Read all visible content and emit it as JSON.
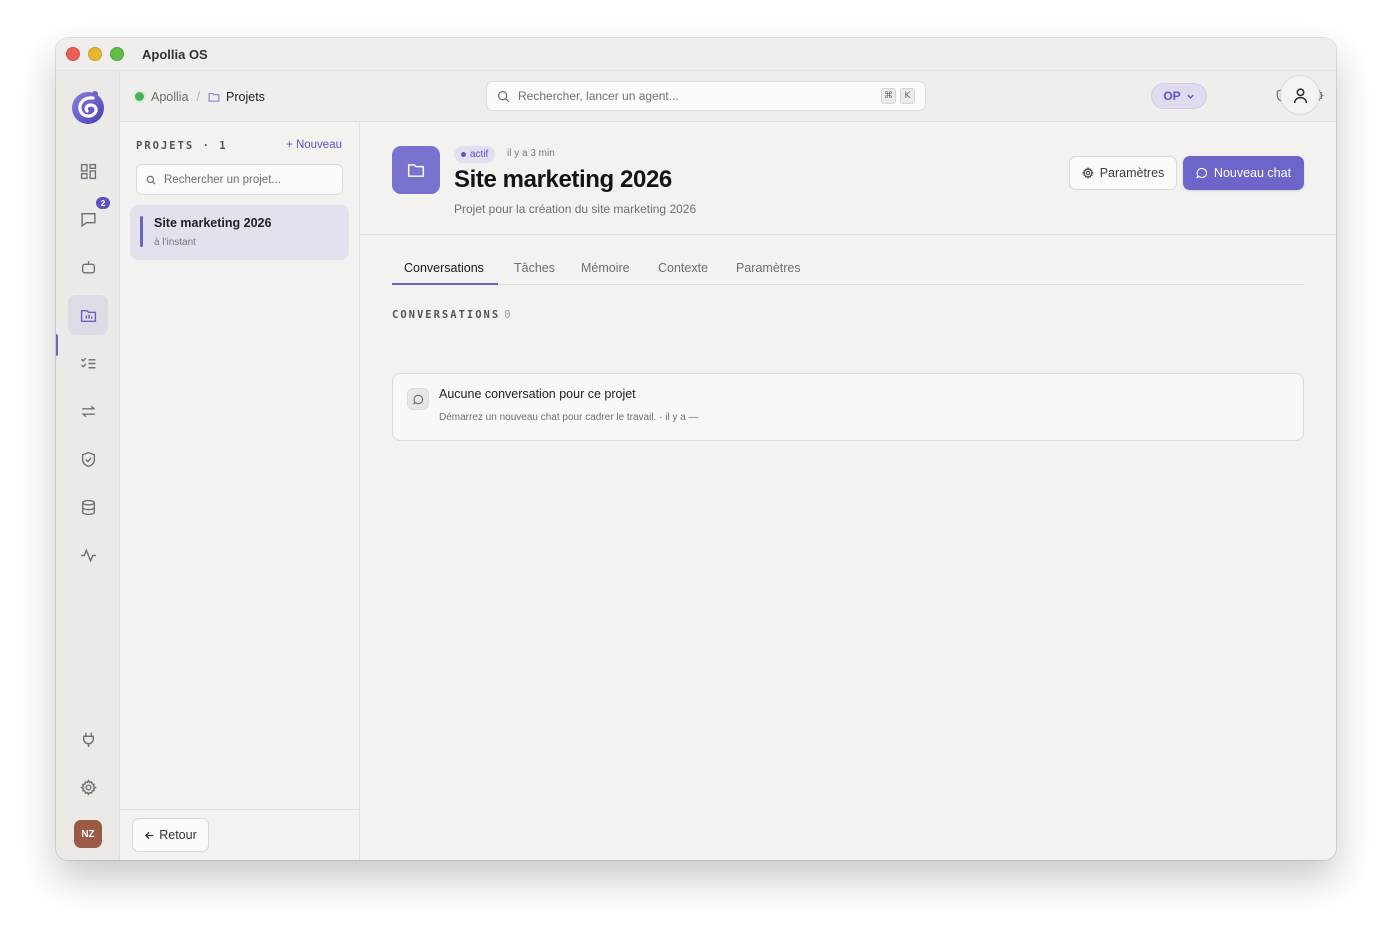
{
  "window": {
    "title": "Apollia OS"
  },
  "rail": {
    "messages_badge": "2",
    "user_initials": "NZ"
  },
  "topbar": {
    "breadcrumb": {
      "root": "Apollia",
      "current": "Projets"
    },
    "search": {
      "placeholder": "Rechercher, lancer un agent...",
      "kbd_cmd": "⌘",
      "kbd_key": "K"
    },
    "workspace_pill": "OP"
  },
  "sidebar": {
    "heading": "PROJETS · 1",
    "new_label": "+ Nouveau",
    "search_placeholder": "Rechercher un projet...",
    "projects": [
      {
        "name": "Site marketing 2026",
        "time": "à l'instant"
      }
    ],
    "back_label": "Retour"
  },
  "project": {
    "status": "actif",
    "updated": "il y a 3 min",
    "title": "Site marketing 2026",
    "description": "Projet pour la création du site marketing 2026",
    "params_label": "Paramètres",
    "new_chat_label": "Nouveau chat"
  },
  "tabs": [
    {
      "label": "Conversations",
      "active": true
    },
    {
      "label": "Tâches"
    },
    {
      "label": "Mémoire"
    },
    {
      "label": "Contexte"
    },
    {
      "label": "Paramètres"
    }
  ],
  "conversations": {
    "heading": "CONVERSATIONS",
    "count": "0",
    "empty_title": "Aucune conversation pour ce projet",
    "empty_sub": "Démarrez un nouveau chat pour cadrer le travail.  · il y a —"
  },
  "colors": {
    "accent": "#6a63c4",
    "accent_button": "#6d65c9"
  }
}
